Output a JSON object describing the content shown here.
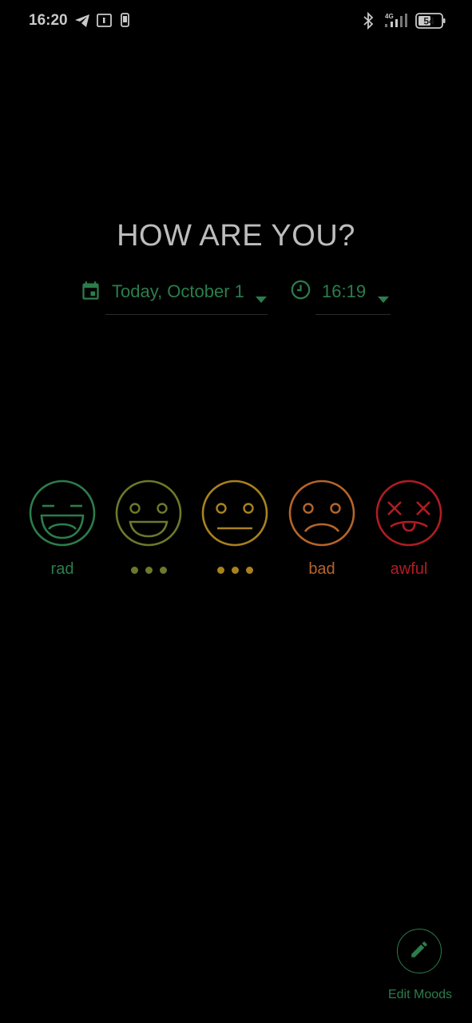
{
  "status_bar": {
    "time": "16:20",
    "battery": "54",
    "network": "4G",
    "icons": [
      "telegram-icon",
      "sim-1-icon",
      "phone-icon",
      "bluetooth-icon",
      "signal-icon",
      "battery-icon"
    ]
  },
  "header": {
    "question": "HOW ARE YOU?"
  },
  "date_picker": {
    "label": "Today, October 1",
    "icon": "calendar-icon"
  },
  "time_picker": {
    "label": "16:19",
    "icon": "clock-icon"
  },
  "moods": [
    {
      "id": "rad",
      "label": "rad",
      "color": "#2c7d4b",
      "icon": "laughing-face-icon"
    },
    {
      "id": "good",
      "label": "",
      "color": "#6b7a2a",
      "icon": "smiling-face-icon"
    },
    {
      "id": "meh",
      "label": "",
      "color": "#a9821f",
      "icon": "neutral-face-icon"
    },
    {
      "id": "bad",
      "label": "bad",
      "color": "#b5652a",
      "icon": "frowning-face-icon"
    },
    {
      "id": "awful",
      "label": "awful",
      "color": "#b01c22",
      "icon": "dizzy-face-icon"
    }
  ],
  "edit_moods": {
    "label": "Edit Moods",
    "icon": "pencil-icon"
  },
  "colors": {
    "accent": "#2c7d4b",
    "background": "#000000",
    "text": "#bdbdbd"
  }
}
